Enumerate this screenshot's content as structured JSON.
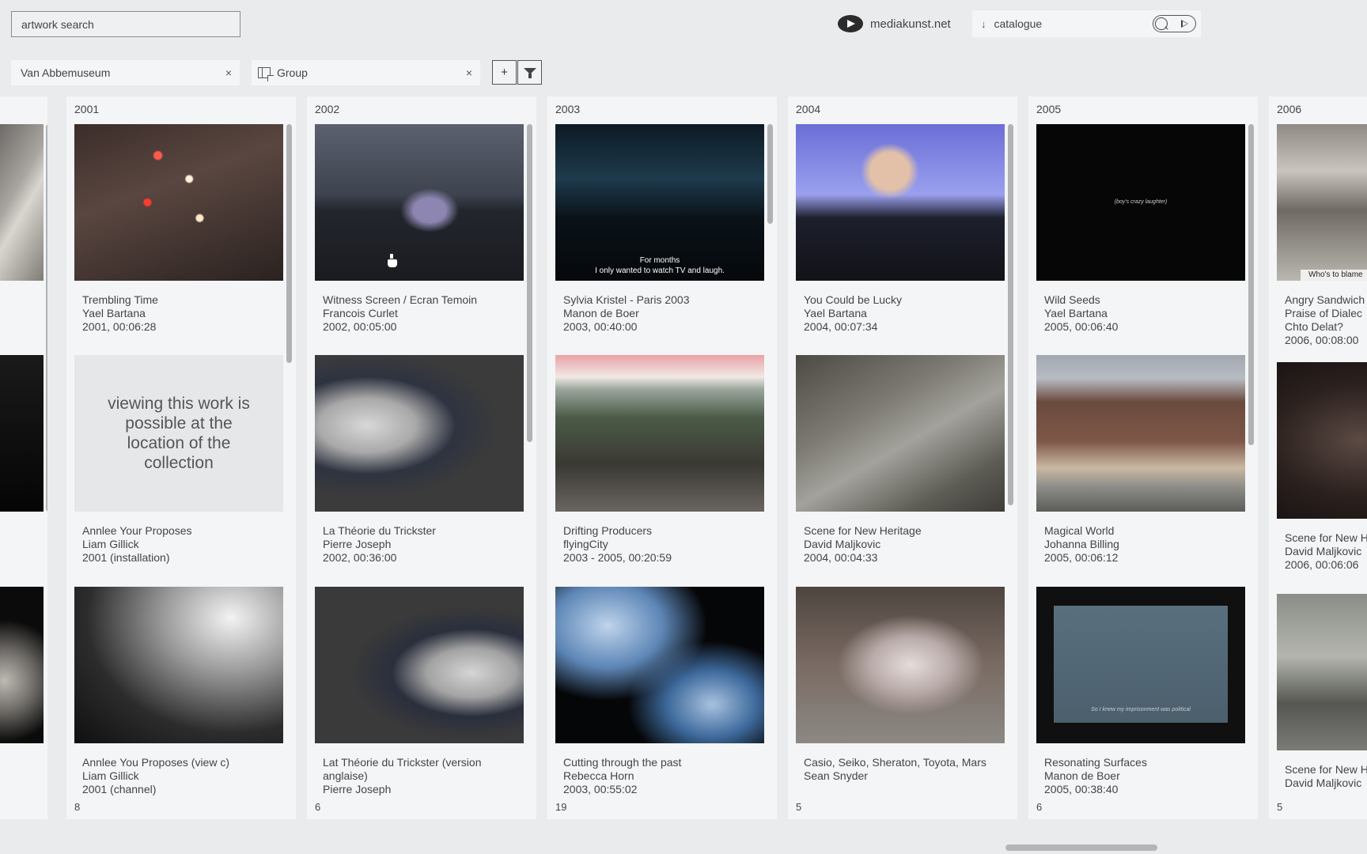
{
  "search": {
    "value": "artwork search"
  },
  "brand": {
    "label": "mediakunst.net"
  },
  "catalogue": {
    "arrow": "↓",
    "label": "catalogue"
  },
  "filters": [
    {
      "label": "Van Abbemuseum",
      "close": "×"
    },
    {
      "label": "Group",
      "close": "×"
    }
  ],
  "actions": {
    "add": "+"
  },
  "columns": [
    {
      "year": "2001",
      "count": "8",
      "items": [
        {
          "title": "Trembling Time",
          "artist": "Yael Bartana",
          "info": "2001, 00:06:28"
        },
        {
          "title": "Annlee Your Proposes",
          "artist": "Liam Gillick",
          "info": "2001 (installation)",
          "unavailable": "viewing this work is possible at the location of the collection"
        },
        {
          "title": "Annlee You Proposes (view c)",
          "artist": "Liam Gillick",
          "info": "2001 (channel)"
        }
      ]
    },
    {
      "year": "2002",
      "count": "6",
      "items": [
        {
          "title": "Witness Screen / Ecran Temoin",
          "artist": "Francois Curlet",
          "info": "2002, 00:05:00"
        },
        {
          "title": "La Théorie du Trickster",
          "artist": "Pierre Joseph",
          "info": "2002, 00:36:00"
        },
        {
          "title": "Lat Théorie du Trickster (version anglaise)",
          "artist": "Pierre Joseph",
          "info": ""
        }
      ]
    },
    {
      "year": "2003",
      "count": "19",
      "items": [
        {
          "title": "Sylvia Kristel - Paris 2003",
          "artist": "Manon de Boer",
          "info": "2003, 00:40:00",
          "subtitle": [
            "For months",
            "I only wanted to watch TV and laugh."
          ]
        },
        {
          "title": "Drifting Producers",
          "artist": "flyingCity",
          "info": "2003 - 2005, 00:20:59"
        },
        {
          "title": "Cutting through the past",
          "artist": "Rebecca Horn",
          "info": "2003, 00:55:02"
        }
      ]
    },
    {
      "year": "2004",
      "count": "5",
      "items": [
        {
          "title": "You Could be Lucky",
          "artist": "Yael Bartana",
          "info": "2004, 00:07:34"
        },
        {
          "title": "Scene for New Heritage",
          "artist": "David Maljkovic",
          "info": "2004, 00:04:33"
        },
        {
          "title": "Casio, Seiko, Sheraton, Toyota, Mars",
          "artist": "Sean Snyder",
          "info": ""
        }
      ]
    },
    {
      "year": "2005",
      "count": "6",
      "items": [
        {
          "title": "Wild Seeds",
          "artist": "Yael Bartana",
          "info": "2005, 00:06:40",
          "subtitle": [
            "(boy's crazy laughter)"
          ]
        },
        {
          "title": "Magical World",
          "artist": "Johanna Billing",
          "info": "2005, 00:06:12"
        },
        {
          "title": "Resonating Surfaces",
          "artist": "Manon de Boer",
          "info": "2005, 00:38:40",
          "subtitle": [
            "So I knew my imprisonment was political"
          ]
        }
      ]
    },
    {
      "year": "2006",
      "count": "5",
      "items": [
        {
          "title": "Angry Sandwich",
          "title2": "Praise of Dialec",
          "artist": "Chto Delat?",
          "info": "2006, 00:08:00",
          "subtitle": [
            "Who's to blame"
          ]
        },
        {
          "title": "Scene for New H",
          "artist": "David Maljkovic",
          "info": "2006, 00:06:06"
        },
        {
          "title": "Scene for New H",
          "artist": "David Maljkovic",
          "info": ""
        }
      ]
    }
  ],
  "colors": {
    "background": "#e9ebed",
    "column": "#f4f5f6",
    "text": "#444444"
  }
}
